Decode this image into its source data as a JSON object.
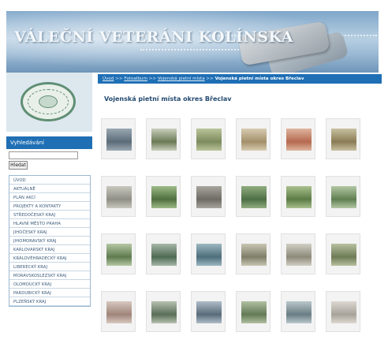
{
  "header": {
    "title": "VÁLEČNÍ VETERÁNI KOLÍNSKA"
  },
  "sidebar": {
    "search_heading": "Vyhledávání",
    "search_button": "Hledat",
    "menu": [
      "ÚVOD",
      "AKTUÁLNĚ",
      "PLÁN AKCÍ",
      "PROJEKTY A KONTAKTY",
      "STŘEDOČESKÝ KRAJ",
      "HLAVNÍ MĚSTO PRAHA",
      "JIHOČESKÝ KRAJ",
      "JIHOMORAVSKÝ KRAJ",
      "KARLOVARSKÝ KRAJ",
      "KRÁLOVÉHRADECKÝ KRAJ",
      "LIBERECKÝ KRAJ",
      "MORAVSKOSLEZSKÝ KRAJ",
      "OLOMOUCKÝ KRAJ",
      "PARDUBICKÝ KRAJ",
      "PLZEŇSKÝ KRAJ"
    ]
  },
  "breadcrumb": {
    "items": [
      "Úvod",
      "Fotoalbum",
      "Vojenská pietní místa",
      "Vojenská pietní místa okres Břeclav"
    ],
    "separator": ">>"
  },
  "main": {
    "title": "Vojenská pietní místa okres Břeclav"
  },
  "colors": {
    "accent_blue": "#1f6fb5",
    "menu_text": "#3a5a7a"
  }
}
